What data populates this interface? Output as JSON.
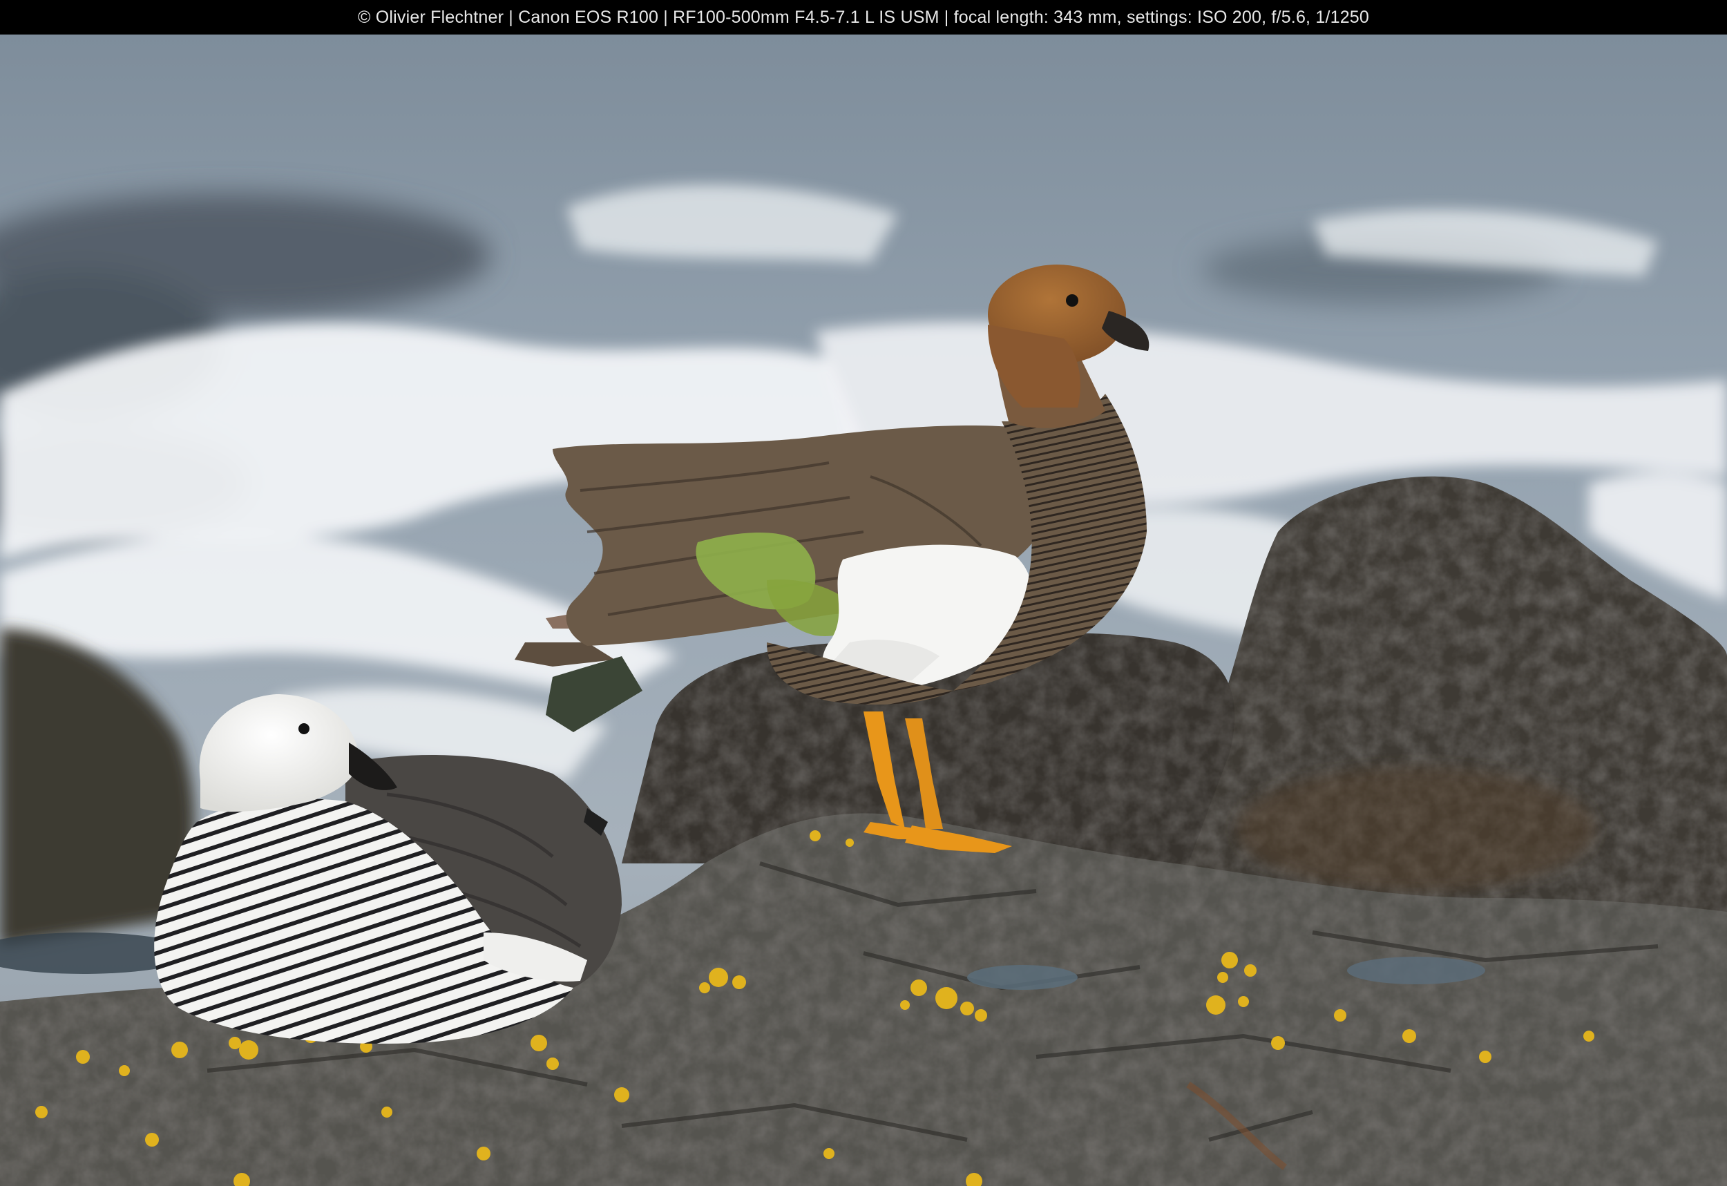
{
  "caption": "© Olivier Flechtner | Canon EOS R100 | RF100-500mm F4.5-7.1 L IS USM | focal length: 343 mm, settings: ISO 200, f/5.6, 1/1250",
  "colors": {
    "caption_bar": "#000000",
    "caption_text": "#e8e8e8",
    "sea": "#8a98a6",
    "foam": "#f2f4f6",
    "rock_dark": "#3b3935",
    "rock_mid": "#5d5c57",
    "lichen": "#e0b21e",
    "goose_head_brown": "#9c6230",
    "goose_body_brown": "#6f5e4c",
    "goose_legs": "#e8961a",
    "speculum_green": "#8fb04a"
  }
}
